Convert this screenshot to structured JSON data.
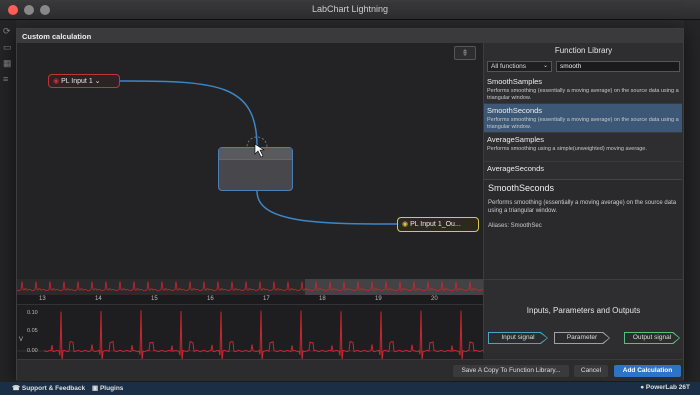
{
  "app": {
    "title": "LabChart Lightning"
  },
  "dialog": {
    "title": "Custom calculation"
  },
  "nodes": {
    "input_label": "PL Input 1",
    "output_label": "PL Input 1_Ou..."
  },
  "ruler": {
    "ticks": [
      "13",
      "14",
      "15",
      "16",
      "17",
      "18",
      "19",
      "20"
    ]
  },
  "scale": {
    "labels": [
      "0.10",
      "0.05",
      "0.00"
    ],
    "unit": "V"
  },
  "library": {
    "title": "Function Library",
    "filter": "All functions",
    "search": "smooth",
    "items": [
      {
        "name": "SmoothSamples",
        "desc": "Performs smoothing (essentially a moving average) on the source data using a triangular window."
      },
      {
        "name": "SmoothSeconds",
        "desc": "Performs smoothing (essentially a moving average) on the source data using a triangular window."
      },
      {
        "name": "AverageSamples",
        "desc": "Performs smoothing using a simple(unweighted) moving average."
      },
      {
        "name": "AverageSeconds",
        "desc": ""
      }
    ],
    "selected_index": 1,
    "detail": {
      "name": "SmoothSeconds",
      "desc": "Performs smoothing (essentially a moving average) on the source data using a triangular window.",
      "aliases": "Aliases: SmoothSec"
    }
  },
  "ipo": {
    "title": "Inputs, Parameters and Outputs",
    "input": "Input signal",
    "param": "Parameter",
    "output": "Output signal"
  },
  "footer": {
    "save": "Save A Copy To Function Library...",
    "cancel": "Cancel",
    "add": "Add Calculation"
  },
  "status": {
    "support": "Support & Feedback",
    "plugins": "Plugins",
    "device": "PowerLab 26T"
  },
  "colors": {
    "input_node": "#c0353a",
    "output_node": "#d8c84a",
    "wire": "#3d86c6",
    "accent": "#2d74c4",
    "trace": "#c8262e"
  }
}
